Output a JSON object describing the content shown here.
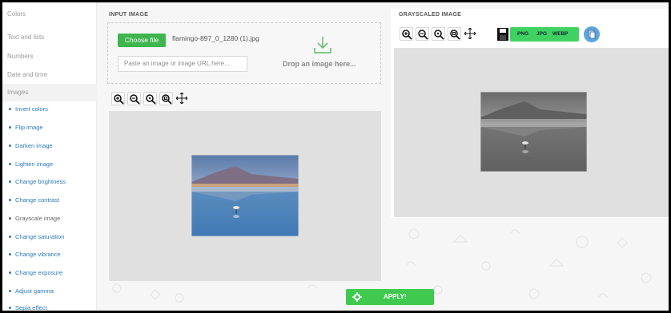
{
  "sidebar": {
    "categories": [
      {
        "label": "Colors"
      },
      {
        "label": "Text and lists"
      },
      {
        "label": "Numbers"
      },
      {
        "label": "Date and time"
      },
      {
        "label": "Images"
      }
    ],
    "active_category": "Images",
    "items": [
      {
        "label": "Invert colors"
      },
      {
        "label": "Flip image"
      },
      {
        "label": "Darken image"
      },
      {
        "label": "Lighten image"
      },
      {
        "label": "Change brightness"
      },
      {
        "label": "Change contrast"
      },
      {
        "label": "Grayscale image"
      },
      {
        "label": "Change saturation"
      },
      {
        "label": "Change vibrance"
      },
      {
        "label": "Change exposure"
      },
      {
        "label": "Adjust gamma"
      },
      {
        "label": "Sepia effect"
      }
    ],
    "current_item": "Grayscale image"
  },
  "input": {
    "title": "INPUT IMAGE",
    "choose_file_label": "Choose file",
    "file_name": "flamingo-897_0_1280 (1).jpg",
    "url_placeholder": "Paste an image or image URL here...",
    "drop_label": "Drop an image here..."
  },
  "output": {
    "title": "GRAYSCALED IMAGE",
    "formats": [
      "PNG",
      "JPG",
      "WEBP"
    ]
  },
  "toolbar": {
    "icons": [
      "zoom-in-icon",
      "zoom-out-icon",
      "zoom-reset-icon",
      "zoom-fit-icon",
      "move-icon"
    ]
  },
  "actions": {
    "apply_label": "APPLY!"
  },
  "colors": {
    "accent_green": "#3fb54e",
    "link_blue": "#2a7bb7"
  }
}
